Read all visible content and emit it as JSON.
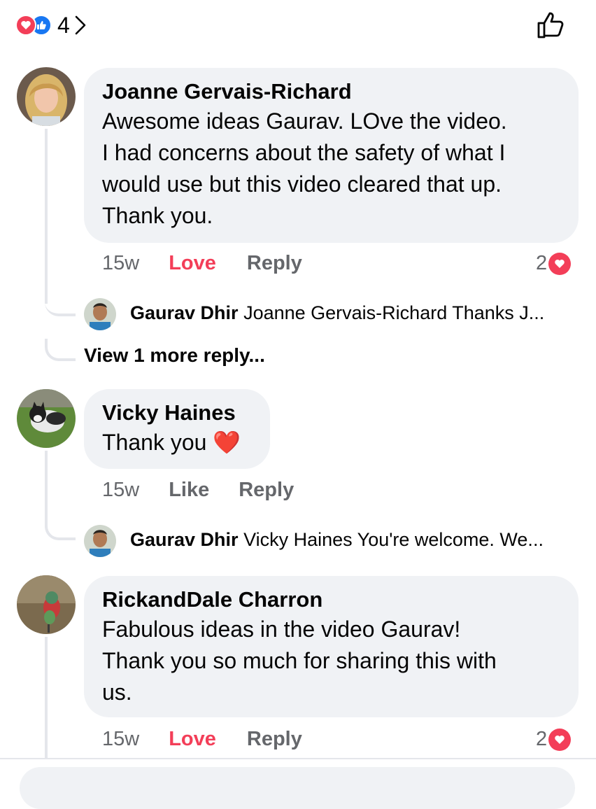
{
  "reactions": {
    "count": "4"
  },
  "colors": {
    "love": "#f33e58",
    "like": "#1877f2",
    "bubble": "#f0f2f5",
    "meta": "#65676b"
  },
  "comments": [
    {
      "author": "Joanne Gervais-Richard",
      "text": [
        "Awesome ideas Gaurav. LOve the video.",
        "I had concerns about the safety of what I",
        "would use but this video cleared that up.",
        "Thank you."
      ],
      "time": "15w",
      "reaction_label": "Love",
      "reply_label": "Reply",
      "reaction_count": "2",
      "reply_preview": {
        "author": "Gaurav Dhir",
        "text": "Joanne Gervais-Richard Thanks J..."
      },
      "view_more": "View 1 more reply..."
    },
    {
      "author": "Vicky Haines",
      "text": [
        "Thank you"
      ],
      "emoji": "❤️",
      "time": "15w",
      "reaction_label": "Like",
      "reply_label": "Reply",
      "reply_preview": {
        "author": "Gaurav Dhir",
        "text": "Vicky Haines You're welcome. We..."
      }
    },
    {
      "author": "RickandDale Charron",
      "text": [
        "Fabulous ideas in the video Gaurav!",
        "Thank you so much for sharing this with",
        "us."
      ],
      "time": "15w",
      "reaction_label": "Love",
      "reply_label": "Reply",
      "reaction_count": "2"
    }
  ]
}
